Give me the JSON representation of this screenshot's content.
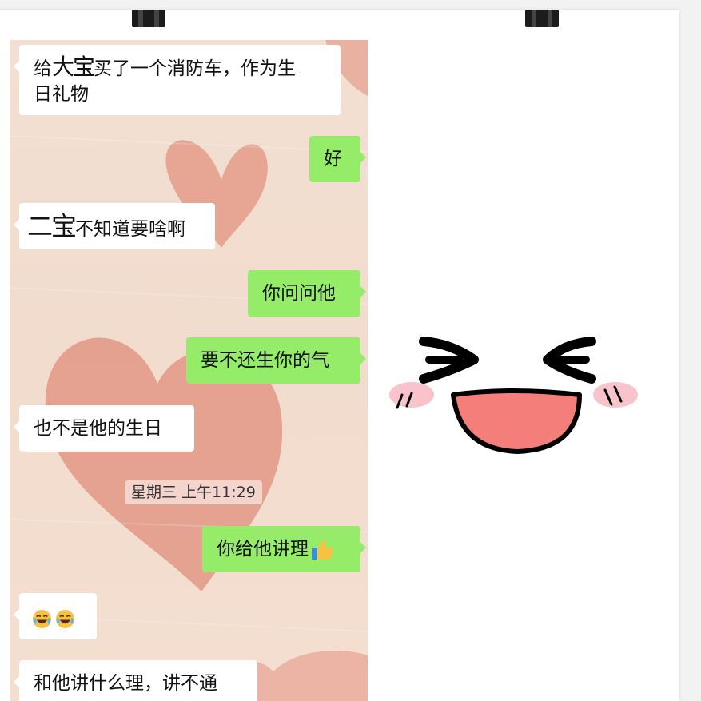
{
  "messages": [
    {
      "side": "in",
      "text_a": "给",
      "text_hand": "大宝",
      "text_b": "买了一个消防车，作为生",
      "text_c": "日礼物"
    },
    {
      "side": "out",
      "text": "好"
    },
    {
      "side": "in",
      "text_hand": "二宝",
      "text_b": "不知道要啥啊"
    },
    {
      "side": "out",
      "text": "你问问他"
    },
    {
      "side": "out",
      "text": "要不还生你的气"
    },
    {
      "side": "in",
      "text": "也不是他的生日"
    },
    {
      "side": "out",
      "text": "你给他讲理",
      "emoji": "thumbs-up-icon"
    },
    {
      "side": "in",
      "emoji": "crying-laughing-face-icon ×2"
    },
    {
      "side": "in",
      "text": "和他讲什么理，讲不通"
    }
  ],
  "timestamp": "星期三 上午11:29",
  "colors": {
    "outgoing_bubble": "#95ec69",
    "incoming_bubble": "#ffffff",
    "chat_background": "#f2dccd",
    "heart": "#e3927f",
    "mouth_fill": "#f47e7a",
    "blush": "#f7a9b6"
  }
}
